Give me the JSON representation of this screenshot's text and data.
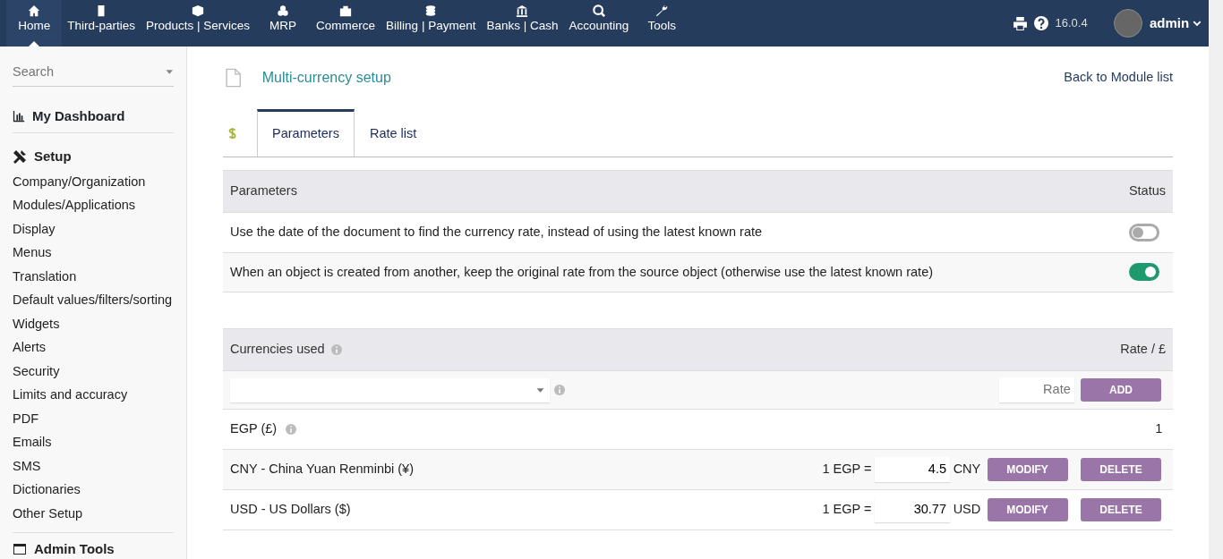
{
  "top_menu": [
    {
      "label": "Home",
      "selected": true
    },
    {
      "label": "Third-parties",
      "selected": false
    },
    {
      "label": "Products | Services",
      "selected": false
    },
    {
      "label": "MRP",
      "selected": false
    },
    {
      "label": "Commerce",
      "selected": false
    },
    {
      "label": "Billing | Payment",
      "selected": false
    },
    {
      "label": "Banks | Cash",
      "selected": false
    },
    {
      "label": "Accounting",
      "selected": false
    },
    {
      "label": "Tools",
      "selected": false
    }
  ],
  "top_right": {
    "version": "16.0.4",
    "user": "admin"
  },
  "sidebar": {
    "search_placeholder": "Search",
    "dashboard": "My Dashboard",
    "section": "Setup",
    "items": [
      "Company/Organization",
      "Modules/Applications",
      "Display",
      "Menus",
      "Translation",
      "Default values/filters/sorting",
      "Widgets",
      "Alerts",
      "Security",
      "Limits and accuracy",
      "PDF",
      "Emails",
      "SMS",
      "Dictionaries",
      "Other Setup"
    ],
    "next_section": "Admin Tools"
  },
  "page": {
    "title": "Multi-currency setup",
    "back_link": "Back to Module list"
  },
  "tabs": [
    {
      "label": "Parameters",
      "selected": true
    },
    {
      "label": "Rate list",
      "selected": false
    }
  ],
  "parameters": {
    "columns": [
      "Parameters",
      "Status"
    ],
    "rows": [
      {
        "text": "Use the date of the document to find the currency rate, instead of using the latest known rate",
        "on": false
      },
      {
        "text": "When an object is created from another, keep the original rate from the source object (otherwise use the latest known rate)",
        "on": true
      }
    ]
  },
  "currencies": {
    "columns": [
      "Currencies used",
      "Rate / £"
    ],
    "rate_placeholder": "Rate",
    "add_button": "ADD",
    "rows": [
      {
        "kind": "base",
        "name": "EGP (£)",
        "rate": "1"
      },
      {
        "kind": "rate",
        "name": "CNY - China Yuan Renminbi (¥)",
        "prefix": "1 EGP =",
        "rate": "4.5",
        "unit": "CNY",
        "modify": "MODIFY",
        "delete": "DELETE"
      },
      {
        "kind": "rate",
        "name": "USD - US Dollars ($)",
        "prefix": "1 EGP =",
        "rate": "30.77",
        "unit": "USD",
        "modify": "MODIFY",
        "delete": "DELETE"
      }
    ]
  }
}
